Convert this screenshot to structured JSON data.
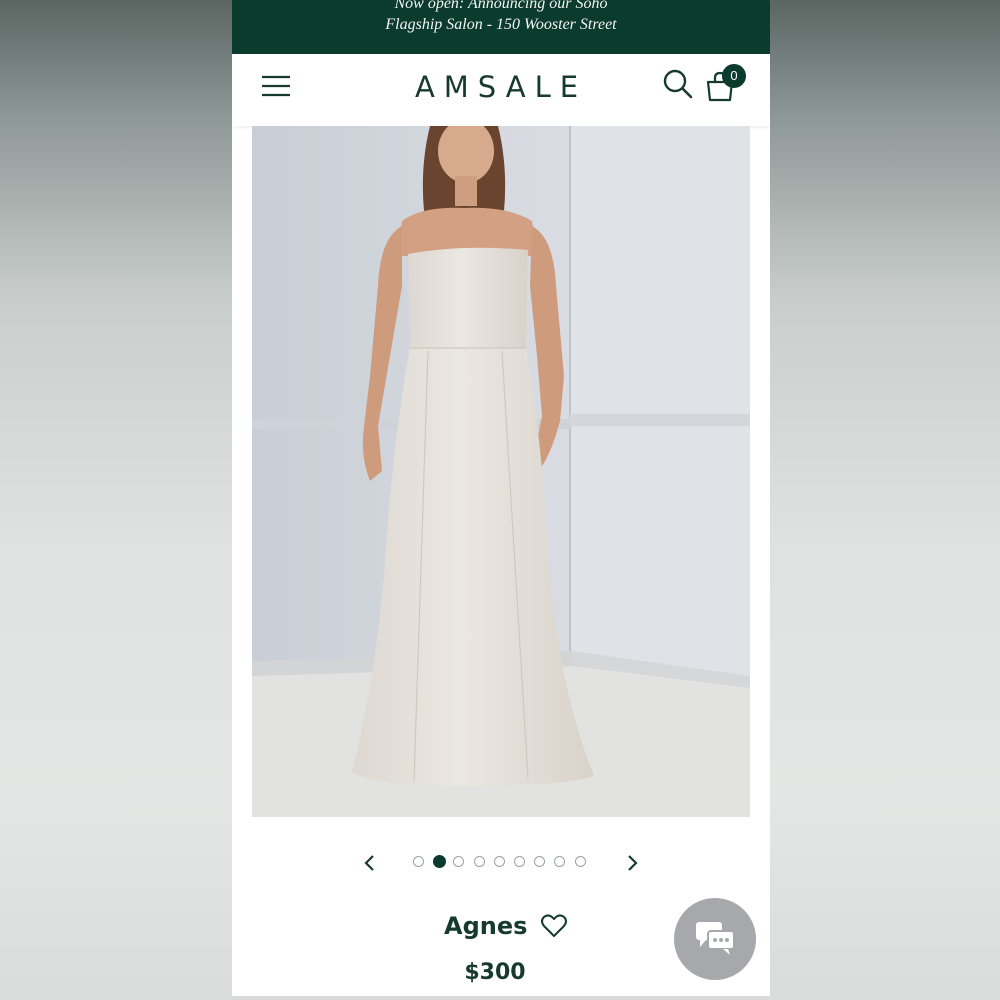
{
  "announcement": {
    "line1": "Now open: Announcing our Soho",
    "line2": "Flagship Salon - 150 Wooster Street"
  },
  "header": {
    "logo_text": "AMSALE",
    "cart_count": "0",
    "icons": [
      "menu-icon",
      "search-icon",
      "shopping-bag-icon"
    ]
  },
  "carousel": {
    "total_slides": 9,
    "active_index": 1,
    "icons": [
      "chevron-left-icon",
      "chevron-right-icon"
    ]
  },
  "product": {
    "name": "Agnes",
    "price": "$300",
    "icons": [
      "heart-icon"
    ]
  },
  "chat": {
    "icon": "chat-bubbles-icon"
  },
  "colors": {
    "brand_green": "#0b3b2c",
    "text_green": "#173a2f",
    "chat_gray": "#a7a8ab"
  }
}
